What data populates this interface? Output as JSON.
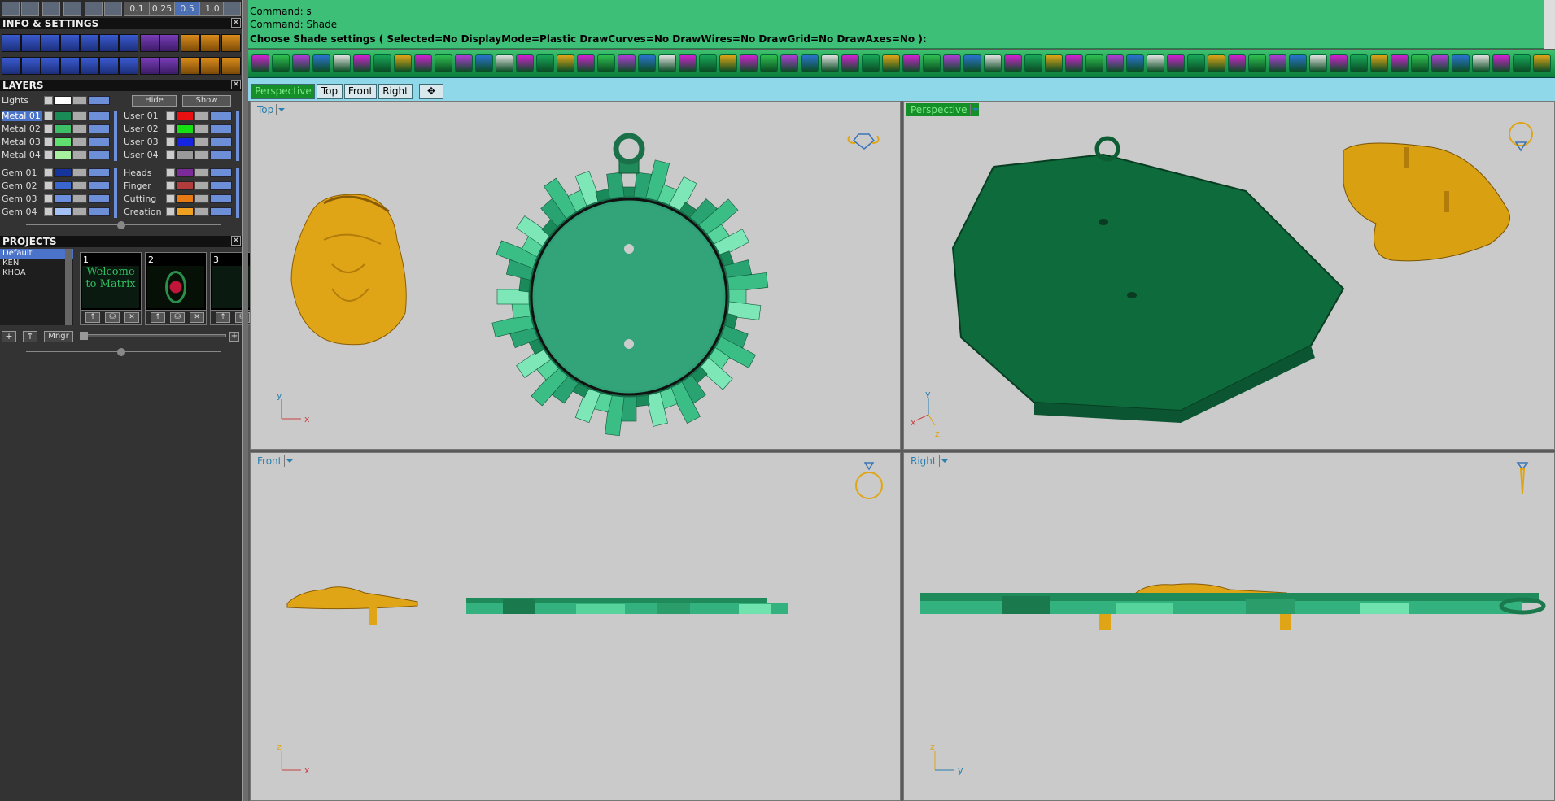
{
  "ribbon": {
    "values": [
      "0.1",
      "0.25",
      "0.5",
      "1.0"
    ],
    "selected": "0.5"
  },
  "info_panel": {
    "title": "INFO & SETTINGS",
    "close": "×"
  },
  "layers": {
    "title": "LAYERS",
    "close": "×",
    "lights": "Lights",
    "hide": "Hide",
    "show": "Show",
    "left": [
      {
        "name": "Metal 01",
        "color": "#1a8a56",
        "sel": true
      },
      {
        "name": "Metal 02",
        "color": "#3cbf66"
      },
      {
        "name": "Metal 03",
        "color": "#5fe06f"
      },
      {
        "name": "Metal 04",
        "color": "#a7f0a0"
      },
      {
        "name": "Gem 01",
        "color": "#15359c"
      },
      {
        "name": "Gem 02",
        "color": "#3b66d0"
      },
      {
        "name": "Gem 03",
        "color": "#6d8fe0"
      },
      {
        "name": "Gem 04",
        "color": "#a3c1f5"
      }
    ],
    "right": [
      {
        "name": "User 01",
        "color": "#e81010"
      },
      {
        "name": "User 02",
        "color": "#14e014"
      },
      {
        "name": "User 03",
        "color": "#1424e0"
      },
      {
        "name": "User 04",
        "color": "#9a9a9a"
      },
      {
        "name": "Heads",
        "color": "#7b2a9a"
      },
      {
        "name": "Finger",
        "color": "#b23b3b"
      },
      {
        "name": "Cutting",
        "color": "#e87a14"
      },
      {
        "name": "Creation",
        "color": "#f0a020"
      }
    ]
  },
  "projects": {
    "title": "PROJECTS",
    "close": "×",
    "items": [
      "Default",
      "KEN",
      "KHOA"
    ],
    "thumbs": [
      {
        "num": "1",
        "text": "Welcome to Matrix"
      },
      {
        "num": "2",
        "text": ""
      },
      {
        "num": "3",
        "text": ""
      }
    ],
    "manager": "Mngr",
    "plus": "+",
    "up": "↑"
  },
  "commands": {
    "line1": "Command: s",
    "line2": "Command: Shade",
    "line3": "Choose Shade settings ( Selected=No  DisplayMode=Plastic  DrawCurves=No  DrawWires=No  DrawGrid=No  DrawAxes=No ):"
  },
  "tabs": [
    {
      "label": "Perspective",
      "active": true
    },
    {
      "label": "Top"
    },
    {
      "label": "Front"
    },
    {
      "label": "Right"
    }
  ],
  "viewports": {
    "top": {
      "label": "Top",
      "ax1": "y",
      "ax2": "x"
    },
    "persp": {
      "label": "Perspective",
      "ax1": "y",
      "ax2": "x",
      "ax3": "z"
    },
    "front": {
      "label": "Front",
      "ax1": "z",
      "ax2": "x"
    },
    "right": {
      "label": "Right",
      "ax1": "z",
      "ax2": "y"
    }
  },
  "colors": {
    "gold": "#e0a516",
    "green": "#1f8a5a",
    "panel": "#333333",
    "top": "#3dbf77"
  }
}
